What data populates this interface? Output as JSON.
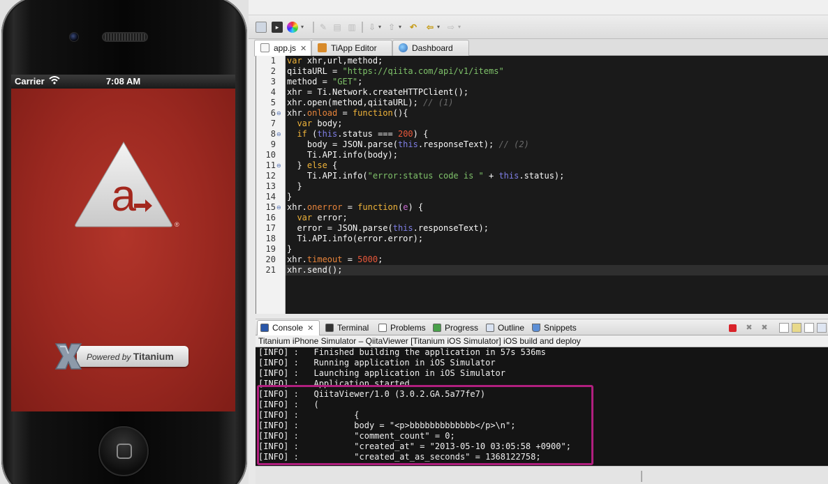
{
  "simulator": {
    "carrier": "Carrier",
    "time": "7:08 AM",
    "logo_letter": "a",
    "registered_mark": "®",
    "powered_by": "Powered by",
    "powered_brand": "Titanium"
  },
  "toolbar": {
    "icons": [
      "monitor-icon",
      "terminal-icon",
      "color-wheel-icon",
      "pen-icon",
      "doc-icon",
      "doc2-icon",
      "next-annotation-icon",
      "prev-annotation-icon",
      "last-edit-icon",
      "back-icon",
      "forward-icon"
    ]
  },
  "editor_tabs": [
    {
      "label": "app.js",
      "active": true,
      "closable": true
    },
    {
      "label": "TiApp Editor",
      "active": false,
      "closable": false
    },
    {
      "label": "Dashboard",
      "active": false,
      "closable": false
    }
  ],
  "code": {
    "language": "javascript",
    "current_line": 21,
    "lines": [
      "var xhr,url,method;",
      "qiitaURL = \"https://qiita.com/api/v1/items\"",
      "method = \"GET\";",
      "xhr = Ti.Network.createHTTPClient();",
      "xhr.open(method,qiitaURL); // (1)",
      "xhr.onload = function(){",
      "  var body;",
      "  if (this.status === 200) {",
      "    body = JSON.parse(this.responseText); // (2)",
      "    Ti.API.info(body);",
      "  } else {",
      "    Ti.API.info(\"error:status code is \" + this.status);",
      "  }",
      "}",
      "xhr.onerror = function(e) {",
      "  var error;",
      "  error = JSON.parse(this.responseText);",
      "  Ti.API.info(error.error);",
      "}",
      "xhr.timeout = 5000;",
      "xhr.send();"
    ],
    "fold_lines": [
      6,
      8,
      11,
      15
    ]
  },
  "console_tabs": [
    {
      "label": "Console",
      "active": true,
      "closable": true
    },
    {
      "label": "Terminal",
      "active": false
    },
    {
      "label": "Problems",
      "active": false
    },
    {
      "label": "Progress",
      "active": false
    },
    {
      "label": "Outline",
      "active": false
    },
    {
      "label": "Snippets",
      "active": false
    }
  ],
  "console": {
    "subtitle": "Titanium iPhone Simulator – QiitaViewer [Titanium iOS Simulator] iOS build and deploy",
    "lines": [
      "[INFO] :   Finished building the application in 57s 536ms",
      "[INFO] :   Running application in iOS Simulator",
      "[INFO] :   Launching application in iOS Simulator",
      "[INFO] :   Application started",
      "[INFO] :   QiitaViewer/1.0 (3.0.2.GA.5a77fe7)",
      "[INFO] :   (",
      "[INFO] :           {",
      "[INFO] :           body = \"<p>bbbbbbbbbbbbb</p>\\n\";",
      "[INFO] :           \"comment_count\" = 0;",
      "[INFO] :           \"created_at\" = \"2013-05-10 03:05:58 +0900\";",
      "[INFO] :           \"created_at_as_seconds\" = 1368122758;"
    ],
    "highlight_color": "#b01f7e"
  }
}
